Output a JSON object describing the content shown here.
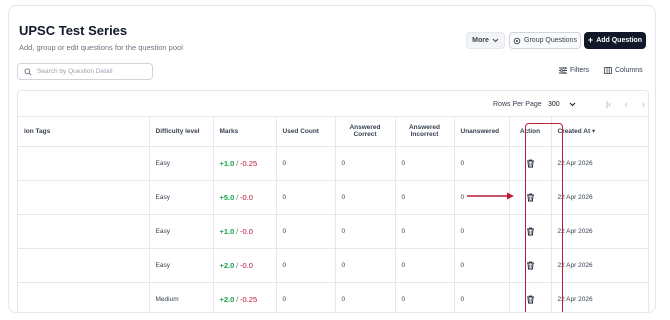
{
  "header": {
    "title": "UPSC Test Series",
    "subtitle": "Add, group or edit questions for the question pool",
    "more_label": "More",
    "group_label": "Group Questions",
    "add_label": "Add Question"
  },
  "search": {
    "placeholder": "Search by Question Detail"
  },
  "toolbar": {
    "filters_label": "Filters",
    "columns_label": "Columns"
  },
  "pagination": {
    "rows_label": "Rows Per Page",
    "rows_value": "300"
  },
  "table": {
    "headers": {
      "tags": "ion Tags",
      "difficulty": "Difficulty level",
      "marks": "Marks",
      "used": "Used Count",
      "correct": "Answered Correct",
      "incorrect": "Answered Incorrect",
      "unanswered": "Unanswered",
      "action": "Action",
      "created": "Created At"
    },
    "rows": [
      {
        "difficulty": "Easy",
        "plus": "+1.0",
        "sep": "/",
        "minus": "-0.25",
        "used": "0",
        "correct": "0",
        "incorrect": "0",
        "unanswered": "0",
        "created": "22 Apr 2026"
      },
      {
        "difficulty": "Easy",
        "plus": "+5.0",
        "sep": "/",
        "minus": "-0.0",
        "used": "0",
        "correct": "0",
        "incorrect": "0",
        "unanswered": "0",
        "created": "22 Apr 2026"
      },
      {
        "difficulty": "Easy",
        "plus": "+1.0",
        "sep": "/",
        "minus": "-0.0",
        "used": "0",
        "correct": "0",
        "incorrect": "0",
        "unanswered": "0",
        "created": "22 Apr 2026"
      },
      {
        "difficulty": "Easy",
        "plus": "+2.0",
        "sep": "/",
        "minus": "-0.0",
        "used": "0",
        "correct": "0",
        "incorrect": "0",
        "unanswered": "0",
        "created": "22 Apr 2026"
      },
      {
        "difficulty": "Medium",
        "plus": "+2.0",
        "sep": "/",
        "minus": "-0.25",
        "used": "0",
        "correct": "0",
        "incorrect": "0",
        "unanswered": "0",
        "created": "22 Apr 2026"
      }
    ]
  },
  "colors": {
    "accent": "#111827",
    "positive": "#16a34a",
    "negative": "#be123c",
    "highlight": "#b91c3c"
  },
  "icons": [
    "search-icon",
    "gear-icon",
    "plus-icon",
    "chevron-down-icon",
    "filter-icon",
    "columns-icon",
    "first-page-icon",
    "prev-page-icon",
    "next-page-icon",
    "sort-down-icon",
    "trash-icon",
    "annotation-arrow"
  ]
}
